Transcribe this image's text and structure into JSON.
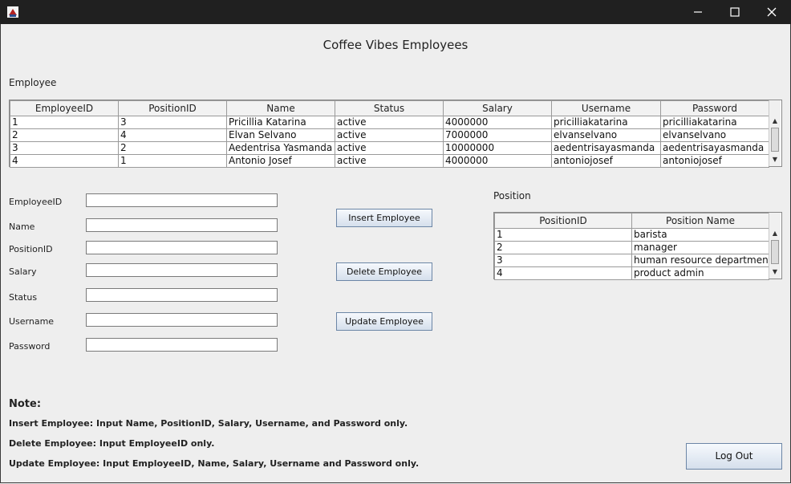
{
  "window": {
    "controls": {
      "minimize": "—",
      "maximize": "☐",
      "close": "✕"
    }
  },
  "page_title": "Coffee Vibes Employees",
  "employee_section": {
    "label": "Employee",
    "columns": [
      "EmployeeID",
      "PositionID",
      "Name",
      "Status",
      "Salary",
      "Username",
      "Password"
    ],
    "rows": [
      [
        "1",
        "3",
        "Pricillia Katarina",
        "active",
        "4000000",
        "pricilliakatarina",
        "pricilliakatarina"
      ],
      [
        "2",
        "4",
        "Elvan Selvano",
        "active",
        "7000000",
        "elvanselvano",
        "elvanselvano"
      ],
      [
        "3",
        "2",
        "Aedentrisa Yasmanda",
        "active",
        "10000000",
        "aedentrisayasmanda",
        "aedentrisayasmanda"
      ],
      [
        "4",
        "1",
        "Antonio Josef",
        "active",
        "4000000",
        "antoniojosef",
        "antoniojosef"
      ]
    ]
  },
  "form": {
    "employee_id_label": "EmployeeID",
    "name_label": "Name",
    "position_id_label": "PositionID",
    "salary_label": "Salary",
    "status_label": "Status",
    "username_label": "Username",
    "password_label": "Password",
    "employee_id_value": "",
    "name_value": "",
    "position_id_value": "",
    "salary_value": "",
    "status_value": "",
    "username_value": "",
    "password_value": ""
  },
  "buttons": {
    "insert": "Insert Employee",
    "delete": "Delete Employee",
    "update": "Update Employee",
    "logout": "Log Out"
  },
  "position_section": {
    "label": "Position",
    "columns": [
      "PositionID",
      "Position Name"
    ],
    "rows": [
      [
        "1",
        "barista"
      ],
      [
        "2",
        "manager"
      ],
      [
        "3",
        "human resource department"
      ],
      [
        "4",
        "product admin"
      ]
    ]
  },
  "notes": {
    "title": "Note:",
    "insert": "Insert Employee: Input Name, PositionID, Salary, Username, and Password only.",
    "delete": "Delete Employee: Input EmployeeID only.",
    "update": "Update Employee: Input EmployeeID, Name, Salary, Username and Password only."
  }
}
